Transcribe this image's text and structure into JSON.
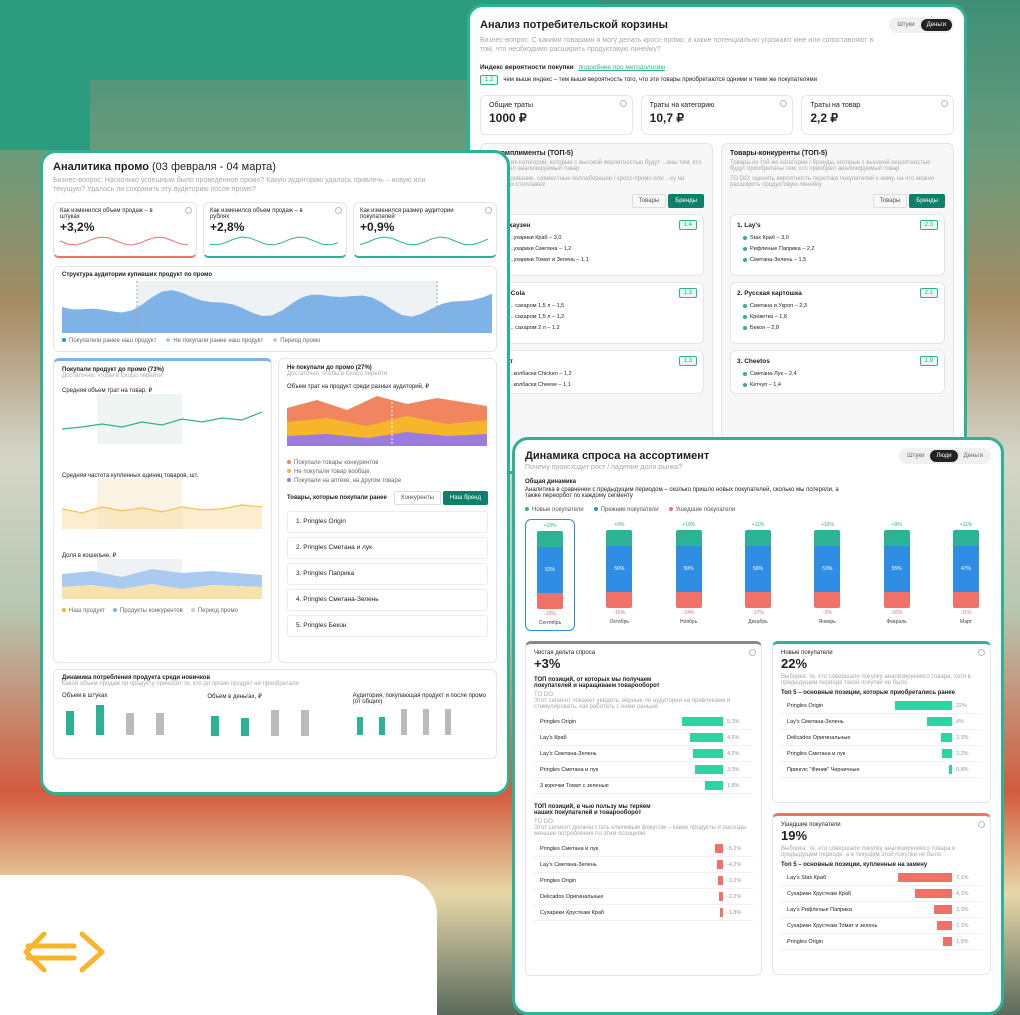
{
  "colors": {
    "accent": "#2cb294",
    "dark_green": "#0e7f6a",
    "red": "#f07167",
    "blue": "#2f8de4",
    "yellow": "#f6b52b",
    "purple": "#7b5bd6"
  },
  "basket": {
    "title": "Анализ потребительской корзины",
    "subtitle": "Бизнес-вопрос: С какими товарами я могу делать кросс-промо, а какие потенциально угрожают мне или сопоставляют в том, что необходимо расширить продуктовую линейку?",
    "toggle": [
      "Штуки",
      "Деньги"
    ],
    "index_label": "Индекс вероятности покупки",
    "index_link": "подробнее про методологию",
    "index_badge": "1.2",
    "index_text": "чем выше индекс – тем выше вероятность того, что эти товары приобретаются одними и теми же покупателями",
    "metrics": [
      {
        "label": "Общие траты",
        "value": "1000 ₽"
      },
      {
        "label": "Траты на категорию",
        "value": "10,7 ₽"
      },
      {
        "label": "Траты на товар",
        "value": "2,2 ₽"
      }
    ],
    "complements": {
      "title": "...-комплименты (ТОП-5)",
      "desc": "...е других категорий, которые с высокой вероятностью будут ...ены тем, кто приобрёл анализируемый товар",
      "todo": "...кладирование, совместные коллаборации / кросс-промо или ...ку на смежных стеллажах",
      "buttons": [
        "Товары",
        "Бренды"
      ],
      "groups": [
        {
          "name": "...ерхаузен",
          "badge": "1.4",
          "items": [
            "...ухарики Краб – 3,0",
            "...ухарики Сметана – 1,2",
            "...ухарики Томат и Зелень – 1,1"
          ]
        },
        {
          "name": "...ca-Cola",
          "badge": "1.3",
          "items": [
            "... сахаром 1,5 л – 1,5",
            "... сахаром 1,5 л – 1,2",
            "... сахаром 2 л – 1,2"
          ]
        },
        {
          "name": "...мет",
          "badge": "1.3",
          "items": [
            "...колбаски Chicken – 1,2",
            "...колбаски Cheese – 1,1"
          ]
        }
      ]
    },
    "competitors": {
      "title": "Товары-конкуренты (ТОП-5)",
      "desc": "Товары из той же категории / бренды, которые с высокой вероятностью будут приобретены тем, кто приобрел анализируемый товар",
      "todo": "TO DO: оценить вероятность перетока покупателей к нему, на что можно расширить продуктовую линейку",
      "buttons": [
        "Товары",
        "Бренды"
      ],
      "groups": [
        {
          "name": "1. Lay's",
          "badge": "2.3",
          "items": [
            "Stax Краб – 3,0",
            "Рифленые Паприка – 2,2",
            "Сметана-Зелень – 1,5"
          ]
        },
        {
          "name": "2. Русская картошка",
          "badge": "2.1",
          "items": [
            "Сметана и Укроп – 2,3",
            "Креветка – 1,8",
            "Бекон – 2,8"
          ]
        },
        {
          "name": "3. Cheetos",
          "badge": "1.9",
          "items": [
            "Сметана-Лук – 2,4",
            "Кетчуп – 1,4"
          ]
        }
      ]
    }
  },
  "promo": {
    "title": "Аналитика промо",
    "dates": "(03 февраля - 04 марта)",
    "subtitle": "Бизнес-вопрос: Насколько успешным было проведенное промо? Какую аудиторию удалось привлечь – новую или текущую? Удалось ли сохранить эту аудиторию после промо?",
    "kpis": [
      {
        "label": "Как изменился объем продаж – в штуках",
        "value": "+3,2%",
        "color": "#f07167"
      },
      {
        "label": "Как изменился объем продаж – в рублях",
        "value": "+2,8%",
        "color": "#2cb294"
      },
      {
        "label": "Как изменился размер аудитории покупателей",
        "value": "+0,9%",
        "color": "#2cb294"
      }
    ],
    "structure_title": "Структура аудитории купивших продукт по промо",
    "structure_legend": [
      "Покупатели ранее наш продукт",
      "Не покупали ранее наш продукт",
      "Период промо"
    ],
    "bought": {
      "title": "Покупали продукт до промо (73%)",
      "sub": "Достаточно, чтобы в Скоро перейти",
      "charts": [
        "Средняя объем трат на товар, ₽",
        "Средняя частота купленных единиц товаров, шт.",
        "Доля в кошельке, ₽"
      ],
      "legend": [
        "Наш продукт",
        "Продукты конкурентов",
        "Период промо"
      ]
    },
    "notbought": {
      "title": "Не покупали до промо (27%)",
      "sub": "Достаточно, чтобы в Скоро перейти",
      "chart_title": "Объем трат на продукт среди разных аудиторий, ₽",
      "legend": [
        "Покупали товары конкурентов",
        "Не покупали товар вообще",
        "Покупали на аптеке, на другом товаре"
      ],
      "list_title": "Товары, которые покупали ранее",
      "buttons": [
        "Конкуренты",
        "Наш бренд"
      ],
      "items": [
        "1. Pringles Origin",
        "2. Pringles Сметана и лук",
        "3. Pringles Паприка",
        "4. Pringles Сметана-Зелень",
        "5. Pringles Бекон"
      ]
    },
    "novice": {
      "title": "Динамика потребления продукта среди новичков",
      "sub": "Какой объем продаж по продукту приносят те, кто до промо продукт не приобретали",
      "cols": [
        "Объем в штуках",
        "Объем в деньгах, ₽",
        "Аудитория, покупающая продукт и после промо (от общих)"
      ]
    }
  },
  "demand": {
    "title": "Динамика спроса на ассортимент",
    "subtitle": "Почему происходит рост / падение доли рынка?",
    "toggle": [
      "Штуки",
      "Люди",
      "Деньги"
    ],
    "section": "Общая динамика",
    "desc": "Аналитика в сравнении с предыдущим периодом – сколько пришло новых покупателей, сколько мы потеряли, а также переорбот по каждому сегменту",
    "legend": [
      "Новые покупатели",
      "Прежние покупатели",
      "Ушедшие покупатели"
    ],
    "months": [
      {
        "m": "Сентябрь",
        "top": "+10%",
        "mid": "53%",
        "bot": "-19%"
      },
      {
        "m": "Октябрь",
        "top": "+9%",
        "mid": "50%",
        "bot": "-16%"
      },
      {
        "m": "Ноябрь",
        "top": "+10%",
        "mid": "50%",
        "bot": "-24%"
      },
      {
        "m": "Декабрь",
        "top": "+11%",
        "mid": "56%",
        "bot": "-17%"
      },
      {
        "m": "Январь",
        "top": "+10%",
        "mid": "53%",
        "bot": "-3%"
      },
      {
        "m": "Февраль",
        "top": "+9%",
        "mid": "55%",
        "bot": "-16%"
      },
      {
        "m": "Март",
        "top": "+11%",
        "mid": "47%",
        "bot": "-11%"
      }
    ],
    "net": {
      "title": "Чистая дельта спроса",
      "value": "+3%",
      "top_title": "ТОП позиций, от которых мы получаем покупателей и наращиваем товарооборот",
      "todo": "TO DO:",
      "todo_text": "Этот сегмент покажет увидеть, верные ли аудитории на привлекаем и стимулировать, как работать с ними раньше",
      "pos": [
        {
          "name": "Pringles Origin",
          "val": "5,3%",
          "w": 0.82
        },
        {
          "name": "Lay's Краб",
          "val": "4,6%",
          "w": 0.66
        },
        {
          "name": "Lay's Сметана-Зелень",
          "val": "4,2%",
          "w": 0.6
        },
        {
          "name": "Pringles Сметана и лук",
          "val": "3,9%",
          "w": 0.55
        },
        {
          "name": "3 корочки Томат с зеленью",
          "val": "1,8%",
          "w": 0.35
        }
      ],
      "neg_title": "ТОП позиций, в чью пользу мы теряем наших покупателей и товарооборот",
      "neg_todo": "TO DO:",
      "neg_text": "Этот сегмент должен стать ключевым фокусом – какие продукты и расходы меньше потребления по этим позициям",
      "neg": [
        {
          "name": "Pringles Сметана и лук",
          "val": "-5,2%",
          "w": 0.8
        },
        {
          "name": "Lay's Сметана-Зелень",
          "val": "-4,2%",
          "w": 0.6
        },
        {
          "name": "Pringles Origin",
          "val": "-3,2%",
          "w": 0.48
        },
        {
          "name": "Delicados Оригинальные",
          "val": "-2,2%",
          "w": 0.35
        },
        {
          "name": "Сухарики Хрустеам Краб",
          "val": "-1,8%",
          "w": 0.3
        }
      ]
    },
    "new": {
      "title": "Новые покупатели",
      "value": "22%",
      "desc": "Выборка: те, кто совершали покупку анализируемого товара, хотя в предыдущем периоде такой покупки не было",
      "top_title": "Топ 5 – основные позиции, которые приобретались ранее",
      "items": [
        {
          "name": "Pringles Origin",
          "val": "22%",
          "w": 0.95
        },
        {
          "name": "Lay's Сметана-Зелень",
          "val": "4%",
          "w": 0.42
        },
        {
          "name": "Delicados Оригинальные",
          "val": "3,3%",
          "w": 0.18
        },
        {
          "name": "Pringles Сметана и лук",
          "val": "3,2%",
          "w": 0.16
        },
        {
          "name": "Принглс \"Финик\" Черничные",
          "val": "0,8%",
          "w": 0.05
        }
      ]
    },
    "lost": {
      "title": "Ушедшие покупатели",
      "value": "19%",
      "desc": "Выборка: те, кто совершали покупку анализируемого товара в предыдущем периоде, а в текущем этой покупки не было",
      "top_title": "Топ 5 – основные позиции, купленные на замену",
      "items": [
        {
          "name": "Lay's Stax Краб",
          "val": "7,1%",
          "w": 0.9
        },
        {
          "name": "Сухарики Хрустеам Краб",
          "val": "4,2%",
          "w": 0.62
        },
        {
          "name": "Lay's Рифленые Паприка",
          "val": "3,3%",
          "w": 0.3
        },
        {
          "name": "Сухарики Хрустеам Томат и зелень",
          "val": "2,2%",
          "w": 0.25
        },
        {
          "name": "Pringles Origin",
          "val": "1,9%",
          "w": 0.15
        }
      ]
    }
  }
}
